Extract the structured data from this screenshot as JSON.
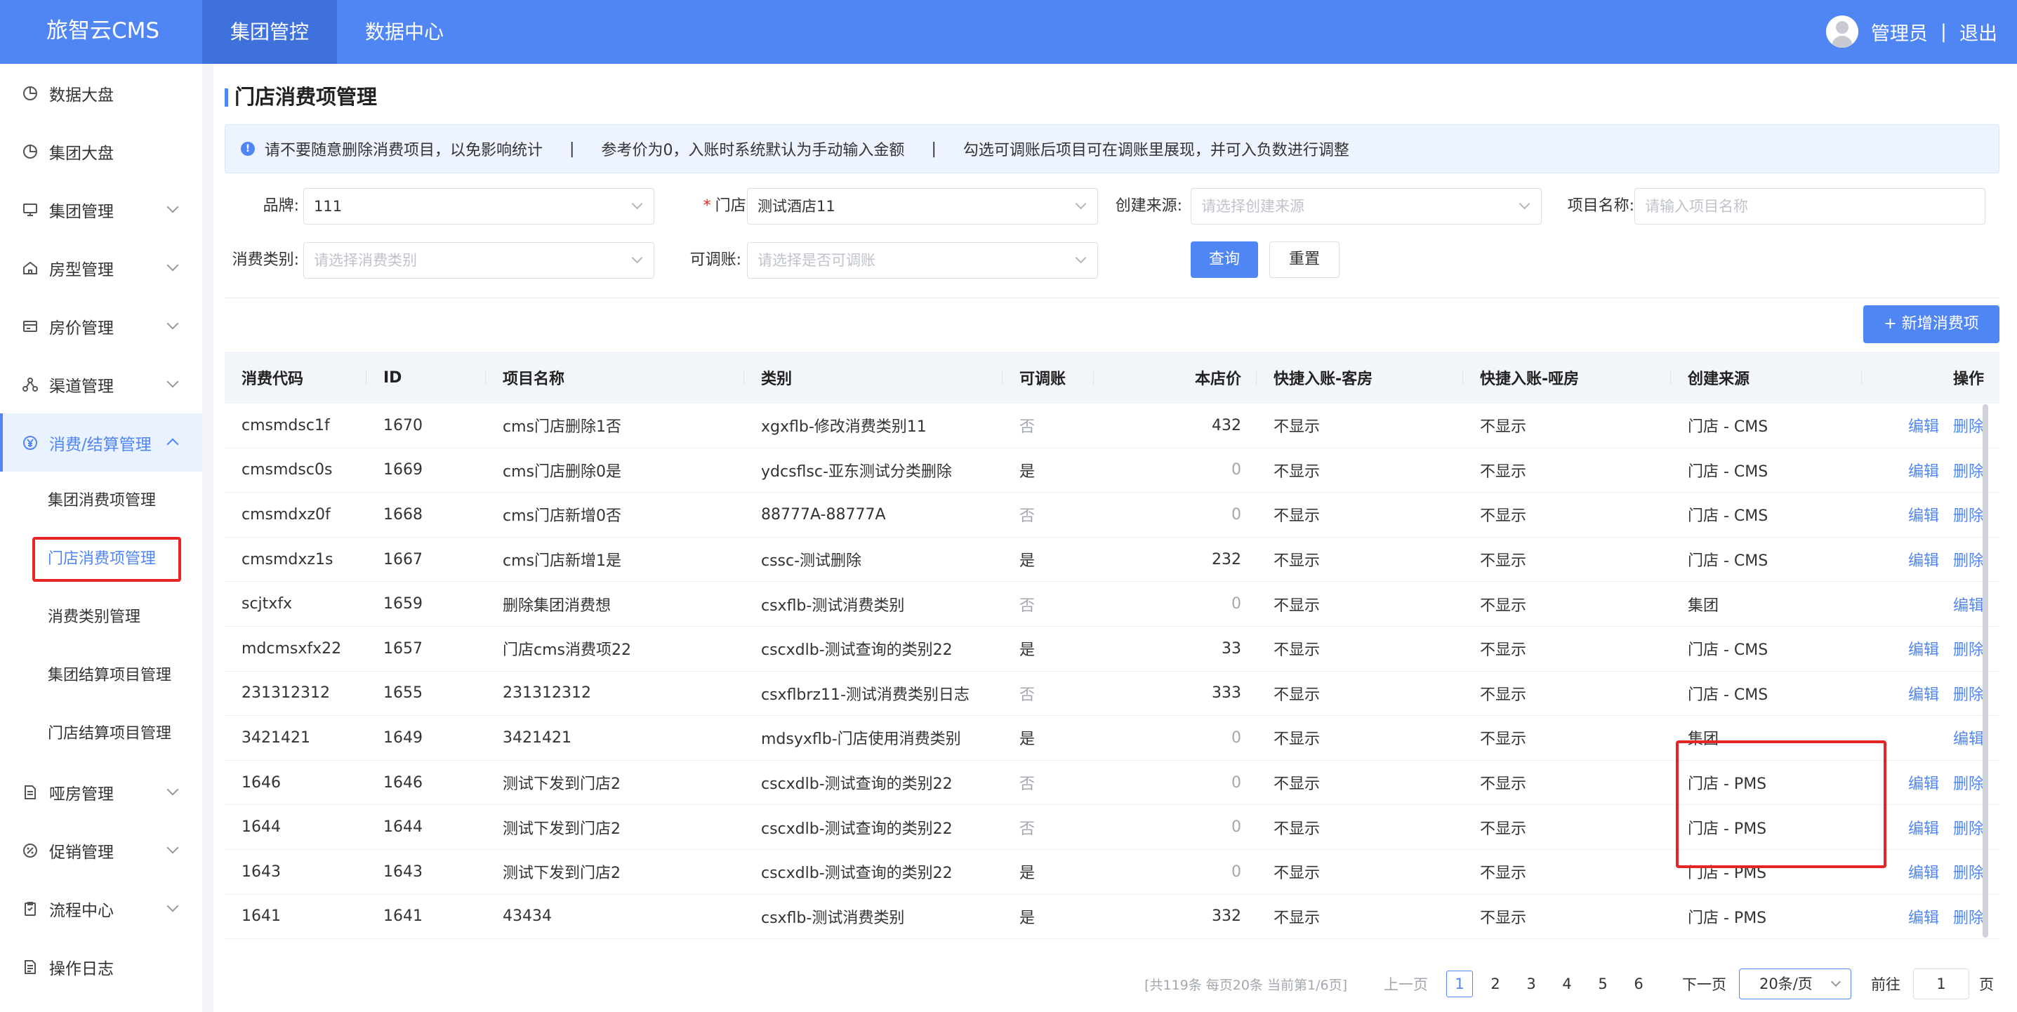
{
  "app": {
    "brand": "旅智云CMS"
  },
  "topnav": [
    {
      "label": "集团管控",
      "active": true
    },
    {
      "label": "数据中心",
      "active": false
    }
  ],
  "user": {
    "name": "管理员",
    "separator": "|",
    "logout": "退出"
  },
  "sidebar": {
    "items": [
      {
        "label": "数据大盘",
        "icon": "pie-chart-icon"
      },
      {
        "label": "集团大盘",
        "icon": "pie-chart-icon"
      },
      {
        "label": "集团管理",
        "icon": "monitor-icon"
      },
      {
        "label": "房型管理",
        "icon": "home-icon"
      },
      {
        "label": "房价管理",
        "icon": "price-tag-icon"
      },
      {
        "label": "渠道管理",
        "icon": "channel-icon"
      },
      {
        "label": "消费/结算管理",
        "icon": "yen-icon"
      },
      {
        "label": "哑房管理",
        "icon": "document-icon"
      },
      {
        "label": "促销管理",
        "icon": "promo-icon"
      },
      {
        "label": "流程中心",
        "icon": "clipboard-icon"
      },
      {
        "label": "操作日志",
        "icon": "log-icon"
      }
    ],
    "submenu": [
      {
        "label": "集团消费项管理"
      },
      {
        "label": "门店消费项管理"
      },
      {
        "label": "消费类别管理"
      },
      {
        "label": "集团结算项目管理"
      },
      {
        "label": "门店结算项目管理"
      }
    ]
  },
  "page": {
    "title": "门店消费项管理"
  },
  "notice": {
    "items": [
      "请不要随意删除消费项目，以免影响统计",
      "参考价为0，入账时系统默认为手动输入金额",
      "勾选可调账后项目可在调账里展现，并可入负数进行调整"
    ],
    "separator": "|"
  },
  "filters": {
    "brand": {
      "label": "品牌:",
      "value": "111"
    },
    "store": {
      "required_mark": "*",
      "label": "门店:",
      "value": "测试酒店11"
    },
    "source": {
      "label": "创建来源:",
      "placeholder": "请选择创建来源"
    },
    "name": {
      "label": "项目名称:",
      "placeholder": "请输入项目名称"
    },
    "category": {
      "label": "消费类别:",
      "placeholder": "请选择消费类别"
    },
    "adjustable": {
      "label": "可调账:",
      "placeholder": "请选择是否可调账"
    },
    "query_button": "查询",
    "reset_button": "重置"
  },
  "add_button": "+ 新增消费项",
  "table": {
    "headers": [
      "消费代码",
      "ID",
      "项目名称",
      "类别",
      "可调账",
      "本店价",
      "快捷入账-客房",
      "快捷入账-哑房",
      "创建来源",
      "操作"
    ],
    "edit_label": "编辑",
    "delete_label": "删除",
    "rows": [
      {
        "code": "cmsmdsc1f",
        "id": "1670",
        "name": "cms门店删除1否",
        "category": "xgxflb-修改消费类别11",
        "adjustable": "否",
        "price": "432",
        "room": "不显示",
        "dummy": "不显示",
        "source": "门店 - CMS",
        "can_delete": true
      },
      {
        "code": "cmsmdsc0s",
        "id": "1669",
        "name": "cms门店删除0是",
        "category": "ydcsflsc-亚东测试分类删除",
        "adjustable": "是",
        "price": "0",
        "room": "不显示",
        "dummy": "不显示",
        "source": "门店 - CMS",
        "can_delete": true
      },
      {
        "code": "cmsmdxz0f",
        "id": "1668",
        "name": "cms门店新增0否",
        "category": "88777A-88777A",
        "adjustable": "否",
        "price": "0",
        "room": "不显示",
        "dummy": "不显示",
        "source": "门店 - CMS",
        "can_delete": true
      },
      {
        "code": "cmsmdxz1s",
        "id": "1667",
        "name": "cms门店新增1是",
        "category": "cssc-测试删除",
        "adjustable": "是",
        "price": "232",
        "room": "不显示",
        "dummy": "不显示",
        "source": "门店 - CMS",
        "can_delete": true
      },
      {
        "code": "scjtxfx",
        "id": "1659",
        "name": "删除集团消费想",
        "category": "csxflb-测试消费类别",
        "adjustable": "否",
        "price": "0",
        "room": "不显示",
        "dummy": "不显示",
        "source": "集团",
        "can_delete": false
      },
      {
        "code": "mdcmsxfx22",
        "id": "1657",
        "name": "门店cms消费项22",
        "category": "cscxdlb-测试查询的类别22",
        "adjustable": "是",
        "price": "33",
        "room": "不显示",
        "dummy": "不显示",
        "source": "门店 - CMS",
        "can_delete": true
      },
      {
        "code": "231312312",
        "id": "1655",
        "name": "231312312",
        "category": "csxflbrz11-测试消费类别日志",
        "adjustable": "否",
        "price": "333",
        "room": "不显示",
        "dummy": "不显示",
        "source": "门店 - CMS",
        "can_delete": true
      },
      {
        "code": "3421421",
        "id": "1649",
        "name": "3421421",
        "category": "mdsyxflb-门店使用消费类别",
        "adjustable": "是",
        "price": "0",
        "room": "不显示",
        "dummy": "不显示",
        "source": "集团",
        "can_delete": false
      },
      {
        "code": "1646",
        "id": "1646",
        "name": "测试下发到门店2",
        "category": "cscxdlb-测试查询的类别22",
        "adjustable": "否",
        "price": "0",
        "room": "不显示",
        "dummy": "不显示",
        "source": "门店 - PMS",
        "can_delete": true
      },
      {
        "code": "1644",
        "id": "1644",
        "name": "测试下发到门店2",
        "category": "cscxdlb-测试查询的类别22",
        "adjustable": "否",
        "price": "0",
        "room": "不显示",
        "dummy": "不显示",
        "source": "门店 - PMS",
        "can_delete": true
      },
      {
        "code": "1643",
        "id": "1643",
        "name": "测试下发到门店2",
        "category": "cscxdlb-测试查询的类别22",
        "adjustable": "是",
        "price": "0",
        "room": "不显示",
        "dummy": "不显示",
        "source": "门店 - PMS",
        "can_delete": true
      },
      {
        "code": "1641",
        "id": "1641",
        "name": "43434",
        "category": "csxflb-测试消费类别",
        "adjustable": "是",
        "price": "332",
        "room": "不显示",
        "dummy": "不显示",
        "source": "门店 - PMS",
        "can_delete": true
      }
    ]
  },
  "pagination": {
    "summary": "[共119条 每页20条 当前第1/6页]",
    "prev": "上一页",
    "pages": [
      "1",
      "2",
      "3",
      "4",
      "5",
      "6"
    ],
    "current": "1",
    "next": "下一页",
    "page_size": "20条/页",
    "goto_label": "前往",
    "goto_value": "1",
    "page_unit": "页"
  },
  "colors": {
    "primary": "#4f86f4",
    "highlight": "#e62424",
    "header_bg": "#4f86f4"
  }
}
